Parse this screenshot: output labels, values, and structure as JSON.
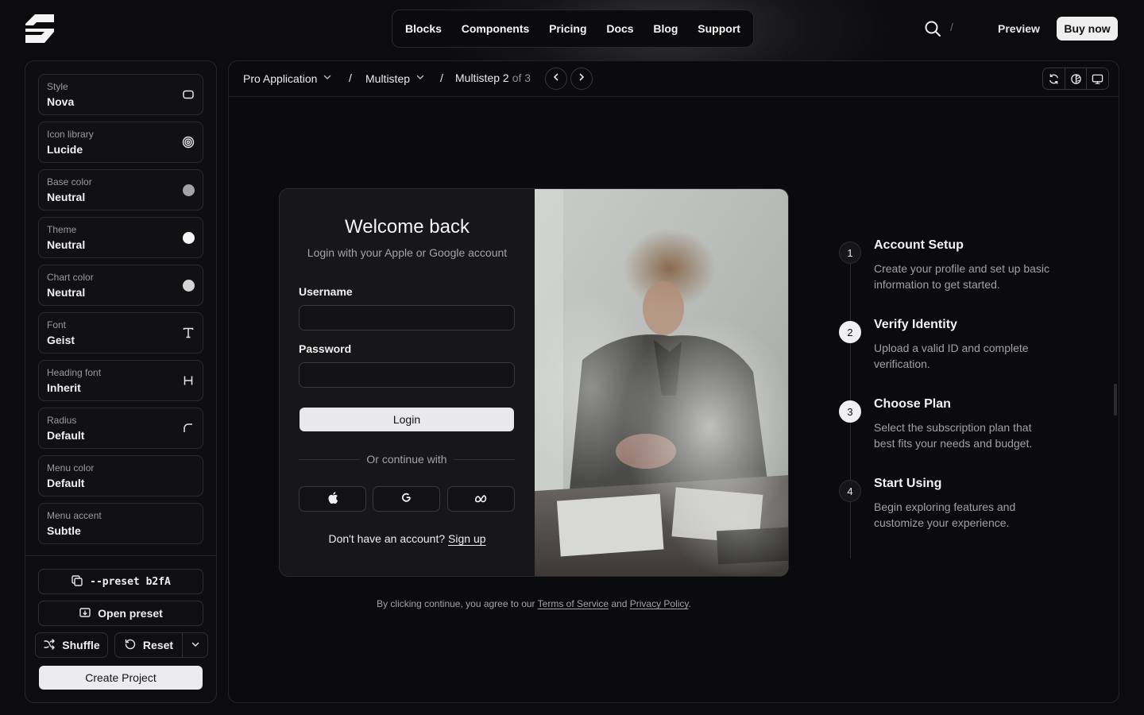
{
  "topnav": {
    "items": [
      "Blocks",
      "Components",
      "Pricing",
      "Docs",
      "Blog",
      "Support"
    ],
    "separator": "/",
    "preview_label": "Preview",
    "buy_label": "Buy now"
  },
  "sidebar": {
    "options": [
      {
        "label": "Style",
        "value": "Nova",
        "icon": "rounded-square-icon"
      },
      {
        "label": "Icon library",
        "value": "Lucide",
        "icon": "spiral-icon"
      },
      {
        "label": "Base color",
        "value": "Neutral",
        "icon": "color-dot-icon",
        "color": "#a3a3a3"
      },
      {
        "label": "Theme",
        "value": "Neutral",
        "icon": "color-dot-icon",
        "color": "#f5f5f5"
      },
      {
        "label": "Chart color",
        "value": "Neutral",
        "icon": "color-dot-icon",
        "color": "#d4d4d4"
      },
      {
        "label": "Font",
        "value": "Geist",
        "icon": "type-icon"
      },
      {
        "label": "Heading font",
        "value": "Inherit",
        "icon": "heading-icon"
      },
      {
        "label": "Radius",
        "value": "Default",
        "icon": "radius-corner-icon"
      },
      {
        "label": "Menu color",
        "value": "Default",
        "icon": ""
      },
      {
        "label": "Menu accent",
        "value": "Subtle",
        "icon": ""
      }
    ],
    "preset_label": "--preset b2fA",
    "open_preset_label": "Open preset",
    "shuffle_label": "Shuffle",
    "reset_label": "Reset",
    "create_label": "Create Project"
  },
  "breadcrumb": {
    "item1": "Pro Application",
    "item2": "Multistep",
    "item3": "Multistep 2",
    "item3_suffix": "of 3",
    "separator": "/"
  },
  "login": {
    "title": "Welcome back",
    "subtitle": "Login with your Apple or Google account",
    "username_label": "Username",
    "username_value": "",
    "password_label": "Password",
    "password_value": "",
    "login_label": "Login",
    "divider_text": "Or continue with",
    "signup_prompt": "Don't have an account?",
    "signup_link": "Sign up"
  },
  "terms": {
    "prefix": "By clicking continue, you agree to our",
    "tos": "Terms of Service",
    "and": "and",
    "privacy": "Privacy Policy",
    "suffix": "."
  },
  "steps": [
    {
      "num": "1",
      "title": "Account Setup",
      "desc": "Create your profile and set up basic information to get started."
    },
    {
      "num": "2",
      "title": "Verify Identity",
      "desc": "Upload a valid ID and complete verification."
    },
    {
      "num": "3",
      "title": "Choose Plan",
      "desc": "Select the subscription plan that best fits your needs and budget."
    },
    {
      "num": "4",
      "title": "Start Using",
      "desc": "Begin exploring features and customize your experience."
    }
  ],
  "active_step": "2"
}
